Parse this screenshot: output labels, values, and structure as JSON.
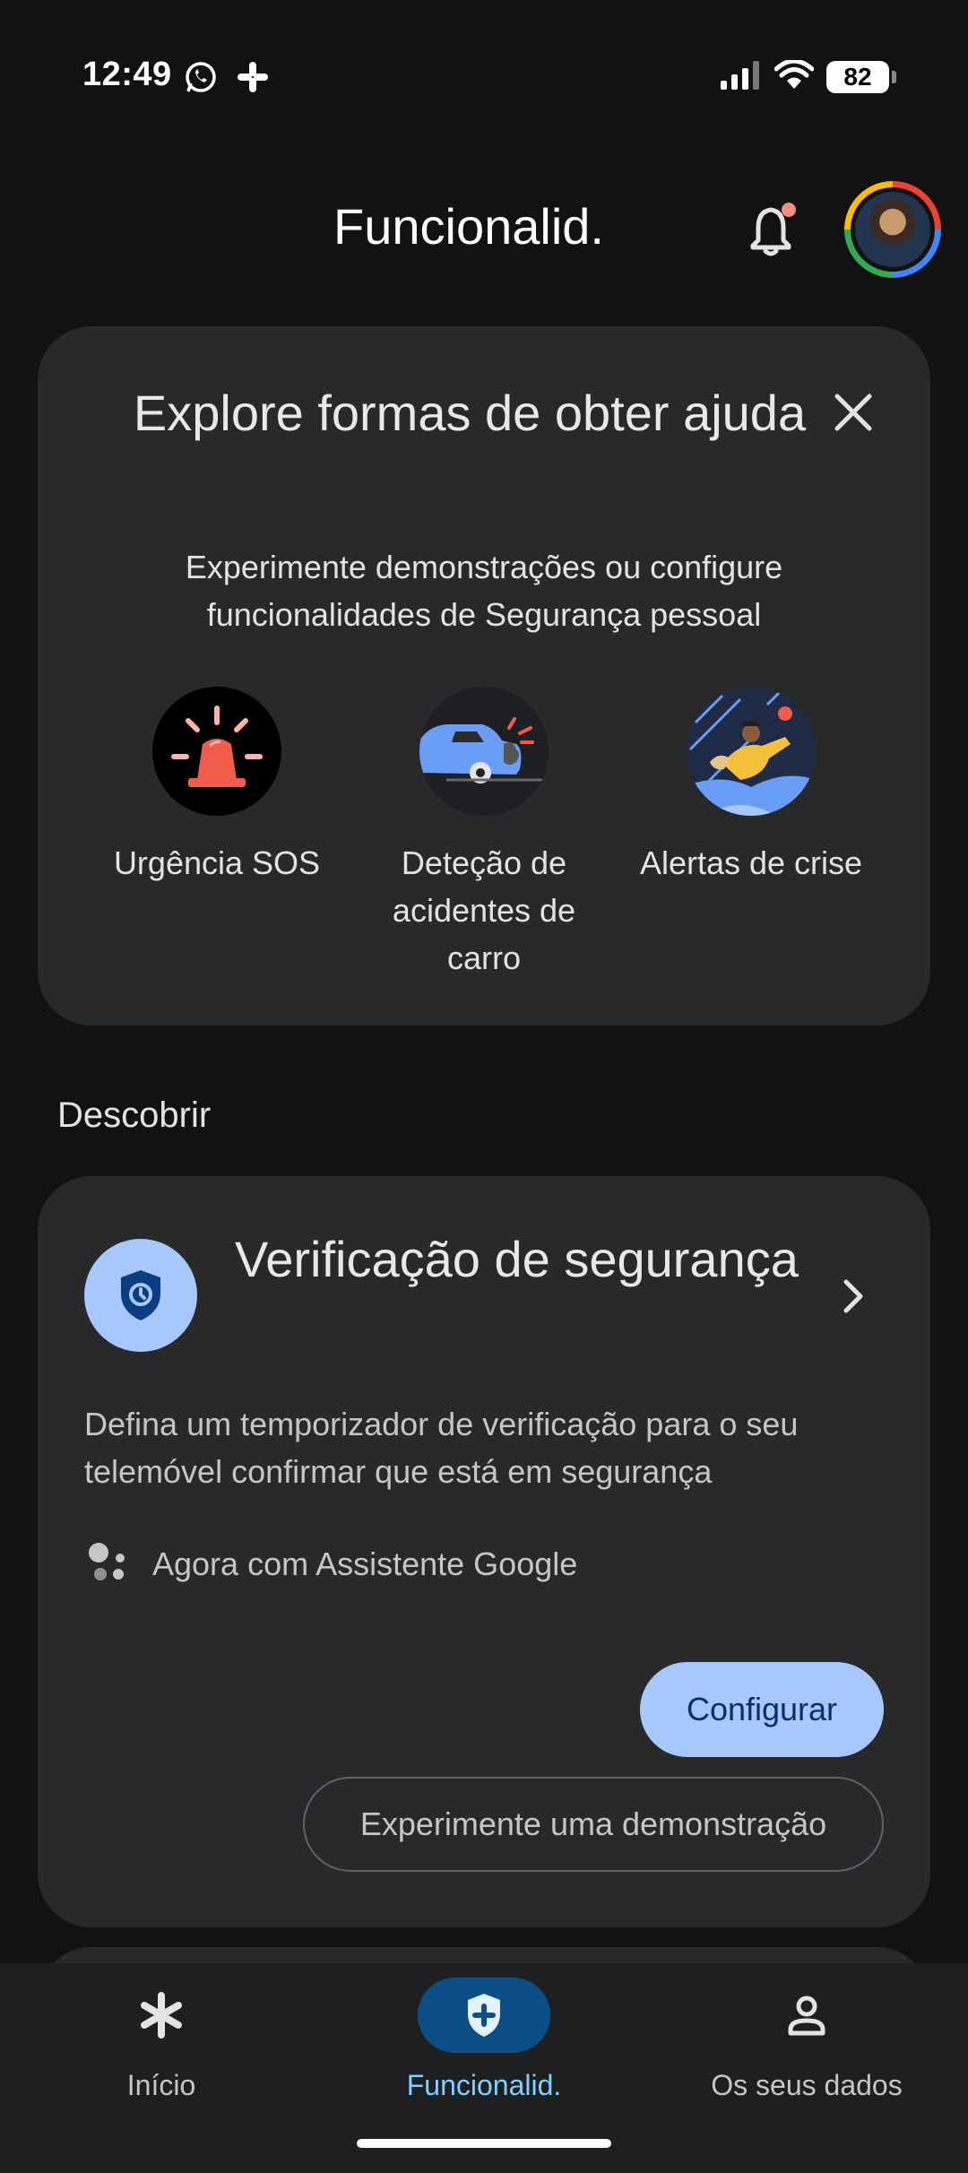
{
  "status_bar": {
    "time": "12:49",
    "battery": "82",
    "icons": [
      "whatsapp-icon",
      "slack-icon",
      "signal-icon",
      "wifi-icon",
      "battery-icon"
    ]
  },
  "header": {
    "title": "Funcionalid.",
    "has_notification": true
  },
  "explore_card": {
    "title": "Explore formas de obter ajuda",
    "subtitle": "Experimente demonstrações ou configure funcionalidades de Segurança pessoal",
    "features": [
      {
        "label": "Urgência SOS",
        "icon": "sos-siren-icon"
      },
      {
        "label": "Deteção de acidentes de carro",
        "icon": "car-crash-icon"
      },
      {
        "label": "Alertas de crise",
        "icon": "crisis-alert-icon"
      }
    ]
  },
  "discover": {
    "section_title": "Descobrir",
    "safety_check": {
      "title": "Verificação de segurança",
      "description": "Defina um temporizador de verificação para o seu telemóvel confirmar que está em segurança",
      "assistant_text": "Agora com Assistente Google",
      "primary_button": "Configurar",
      "secondary_button": "Experimente uma demonstração"
    }
  },
  "bottom_nav": {
    "items": [
      {
        "label": "Início",
        "icon": "asterisk-icon",
        "active": false
      },
      {
        "label": "Funcionalid.",
        "icon": "shield-plus-icon",
        "active": true
      },
      {
        "label": "Os seus dados",
        "icon": "person-icon",
        "active": false
      }
    ]
  },
  "colors": {
    "background": "#121212",
    "card": "#28292b",
    "accent": "#a8c7fa",
    "nav_active": "#0b4f86",
    "nav_active_label": "#7fcfff"
  }
}
